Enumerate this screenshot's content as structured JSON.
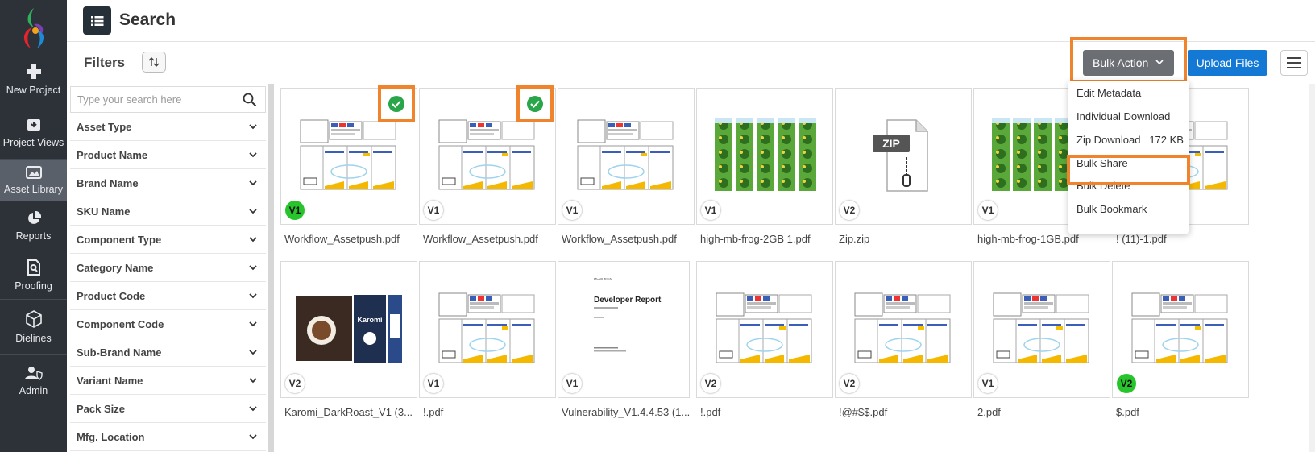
{
  "header": {
    "title": "Search"
  },
  "nav": {
    "items": [
      {
        "label": "New Project",
        "icon": "plus-icon"
      },
      {
        "label": "Project Views",
        "icon": "download-box-icon"
      },
      {
        "label": "Asset Library",
        "icon": "image-icon",
        "active": true
      },
      {
        "label": "Reports",
        "icon": "pie-chart-icon"
      },
      {
        "label": "Proofing",
        "icon": "search-document-icon"
      },
      {
        "label": "Dielines",
        "icon": "cube-icon"
      },
      {
        "label": "Admin",
        "icon": "user-shield-icon"
      }
    ]
  },
  "toolbar": {
    "filters_label": "Filters",
    "bulk_action_label": "Bulk Action",
    "upload_label": "Upload Files"
  },
  "bulk_menu": {
    "items": [
      {
        "label": "Edit Metadata"
      },
      {
        "label": "Individual Download"
      },
      {
        "label": "Zip Download   172 KB"
      },
      {
        "label": "Bulk Share",
        "highlighted": true
      },
      {
        "label": "Bulk Delete"
      },
      {
        "label": "Bulk Bookmark"
      }
    ]
  },
  "filters": {
    "search_placeholder": "Type your search here",
    "items": [
      "Asset Type",
      "Product Name",
      "Brand Name",
      "SKU Name",
      "Component Type",
      "Category Name",
      "Product Code",
      "Component Code",
      "Sub-Brand Name",
      "Variant Name",
      "Pack Size",
      "Mfg. Location"
    ]
  },
  "assets": [
    {
      "name": "Workflow_Assetpush.pdf",
      "version": "V1",
      "version_highlight": true,
      "selected": true,
      "thumb": "dieline"
    },
    {
      "name": "Workflow_Assetpush.pdf",
      "version": "V1",
      "selected": true,
      "thumb": "dieline"
    },
    {
      "name": "Workflow_Assetpush.pdf",
      "version": "V1",
      "thumb": "dieline"
    },
    {
      "name": "high-mb-frog-2GB 1.pdf",
      "version": "V1",
      "thumb": "frog"
    },
    {
      "name": "Zip.zip",
      "version": "V2",
      "thumb": "zip"
    },
    {
      "name": "high-mb-frog-1GB.pdf",
      "version": "V1",
      "thumb": "frog"
    },
    {
      "name": "! (11)-1.pdf",
      "version": "",
      "thumb": "dieline"
    },
    {
      "name": "Karomi_DarkRoast_V1 (3...",
      "version": "V2",
      "thumb": "coffee"
    },
    {
      "name": "!.pdf",
      "version": "V1",
      "thumb": "dieline"
    },
    {
      "name": "Vulnerability_V1.4.4.53 (1...",
      "version": "V1",
      "thumb": "report"
    },
    {
      "name": "!.pdf",
      "version": "V2",
      "thumb": "dieline"
    },
    {
      "name": "!@#$$.pdf",
      "version": "V2",
      "thumb": "dieline"
    },
    {
      "name": "2.pdf",
      "version": "V1",
      "thumb": "dieline"
    },
    {
      "name": "$.pdf",
      "version": "V2",
      "version_highlight": true,
      "thumb": "dieline"
    }
  ],
  "thumb_text": {
    "zip": "ZIP",
    "report_title": "Developer Report",
    "report_brand": "Acumenix",
    "coffee_brand": "Karomi"
  },
  "colors": {
    "accent_highlight": "#f0842c",
    "primary_button": "#1479d4",
    "version_badge_green": "#27c52b",
    "selected_check": "#2aa64a"
  }
}
